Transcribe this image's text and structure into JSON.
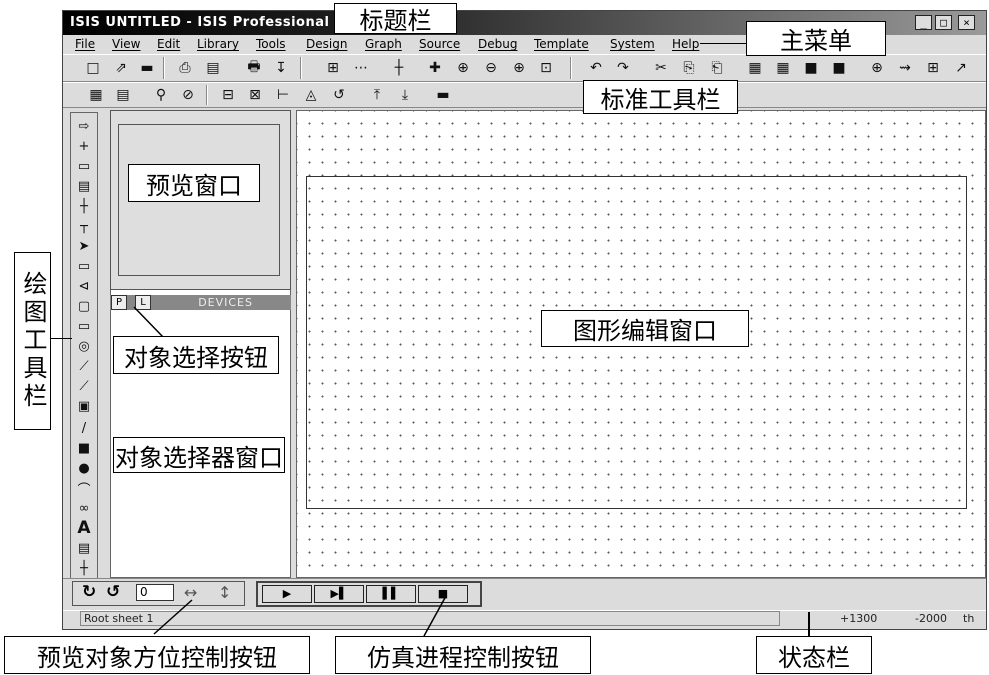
{
  "window": {
    "title": "ISIS UNTITLED - ISIS Professional",
    "controls": [
      "_",
      "□",
      "×"
    ]
  },
  "menu": [
    "File",
    "View",
    "Edit",
    "Library",
    "Tools",
    "Design",
    "Graph",
    "Source",
    "Debug",
    "Template",
    "System",
    "Help"
  ],
  "toolbar1": [
    "□",
    "⇗",
    "▬",
    "⎙",
    "▤",
    "🖶",
    "↧",
    "⊞",
    "⋯",
    "┼",
    "✚",
    "⊕",
    "⊖",
    "⊕",
    "⊡",
    "↶",
    "↷",
    "✂",
    "⎘",
    "⎗",
    "▦",
    "▦",
    "■",
    "■",
    "⊕",
    "⇝",
    "⊞",
    "↗"
  ],
  "toolbar2": [
    "▦",
    "▤",
    "⚲",
    "⊘",
    "⊟",
    "⊠",
    "⊢",
    "◬",
    "↺",
    "⤒",
    "⤓",
    "▬"
  ],
  "left_tools": [
    "⇨",
    "+",
    "▭",
    "▤",
    "┼",
    "┬",
    "➤",
    "▭",
    "⊲",
    "▢",
    "▭",
    "◎",
    "⟋",
    "⟋",
    "▣",
    "/",
    "■",
    "●",
    "⌒",
    "∞",
    "A",
    "▤",
    "┼"
  ],
  "panel": {
    "tab_p": "P",
    "tab_l": "L",
    "devices_label": "DEVICES"
  },
  "bottom": {
    "rotate_ccw": "↻",
    "rotate_cw": "↺",
    "angle_value": "0",
    "mirror_h": "↔",
    "mirror_v": "↕"
  },
  "sim_buttons": [
    "▶",
    "▶▌",
    "▌▌",
    "■"
  ],
  "status": {
    "sheet": "Root sheet 1",
    "coord_x": "+1300",
    "coord_y": "-2000",
    "unit": "th"
  },
  "annotations": {
    "title_bar": "标题栏",
    "main_menu": "主菜单",
    "standard_toolbar": "标准工具栏",
    "preview_window": "预览窗口",
    "drawing_toolbar": "绘图工具栏",
    "object_select_button": "对象选择按钮",
    "object_selector_window": "对象选择器窗口",
    "graphic_edit_window": "图形编辑窗口",
    "orientation_control_buttons": "预览对象方位控制按钮",
    "simulation_control_buttons": "仿真进程控制按钮",
    "status_bar": "状态栏"
  }
}
